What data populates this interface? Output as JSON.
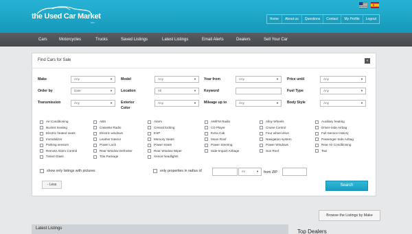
{
  "brand": {
    "logo_text": "the Used Car Market",
    "logo_sub": "com"
  },
  "flags": [
    {
      "name": "us-flag-icon"
    },
    {
      "name": "spain-flag-icon"
    }
  ],
  "topnav": [
    "Home",
    "About us",
    "Questions",
    "Contact",
    "My Profile",
    "Logout"
  ],
  "mainnav": [
    "Cars",
    "Motorcycles",
    "Trucks",
    "Saved Listings",
    "Latest Listings",
    "Email Alerts",
    "Dealers",
    "Sell Your Car"
  ],
  "panel": {
    "title": "Find Cars for Sale",
    "collapse_icon": "«"
  },
  "fields": {
    "make": {
      "label": "Make",
      "value": "Any"
    },
    "model": {
      "label": "Model",
      "value": "Any"
    },
    "year_from": {
      "label": "Year from",
      "value": "Any"
    },
    "price_until": {
      "label": "Price until",
      "value": "Any"
    },
    "order_by": {
      "label": "Order by",
      "value": "Date"
    },
    "location": {
      "label": "Location",
      "value": "All"
    },
    "keyword": {
      "label": "Keyword",
      "value": ""
    },
    "fuel_type": {
      "label": "Fuel Type",
      "value": "Any"
    },
    "transmission": {
      "label": "Transmission",
      "value": "Any"
    },
    "exterior_color": {
      "label_1": "Exterior",
      "label_2": "Color",
      "value": "Any"
    },
    "mileage": {
      "label": "Mileage up to",
      "value": "Any"
    },
    "body_style": {
      "label": "Body Style",
      "value": "Any"
    }
  },
  "features": [
    [
      "Air Conditioning",
      "ABS",
      "Alarm",
      "AM/FM Radio",
      "Alloy Wheels",
      "Auxiliary heating"
    ],
    [
      "Bucket Seating",
      "Cassette Radio",
      "Central locking",
      "CD Player",
      "Cruise Control",
      "Driver-Side Airbag"
    ],
    [
      "Electric heated seats",
      "Electric windows",
      "ESP",
      "Extra Cab",
      "Four wheel drive",
      "Full Service History"
    ],
    [
      "Immobilizer",
      "Leather Interior",
      "Memory Seats",
      "Moon Roof",
      "Navigation system",
      "Passenger-Side Airbag"
    ],
    [
      "Parking sensors",
      "Power Lock",
      "Power Seats",
      "Power Steering",
      "Power Windows",
      "Rear Air Conditioning"
    ],
    [
      "Remote Alarm Control",
      "Rear Window Defroster",
      "Rear Window Wiper",
      "Side-Impact Airbags",
      "Sun Roof",
      "Taxi"
    ],
    [
      "Tinted Glass",
      "Tow Package",
      "Xenon headlights",
      "",
      "",
      ""
    ]
  ],
  "options": {
    "pictures_label": "show only listings with pictures",
    "radius_label": "only properties in radius of",
    "radius_value": "",
    "unit_value": "mi",
    "zip_label": "from ZIP",
    "zip_value": ""
  },
  "buttons": {
    "less": "- Less",
    "search": "Search",
    "browse": "Browse the Listings by Make"
  },
  "sections": {
    "latest": "Latest Listings",
    "top_dealers": "Top Dealers"
  },
  "colors": {
    "header": "#1ea8c8",
    "nav": "#505457",
    "accent": "#22a9c9"
  }
}
